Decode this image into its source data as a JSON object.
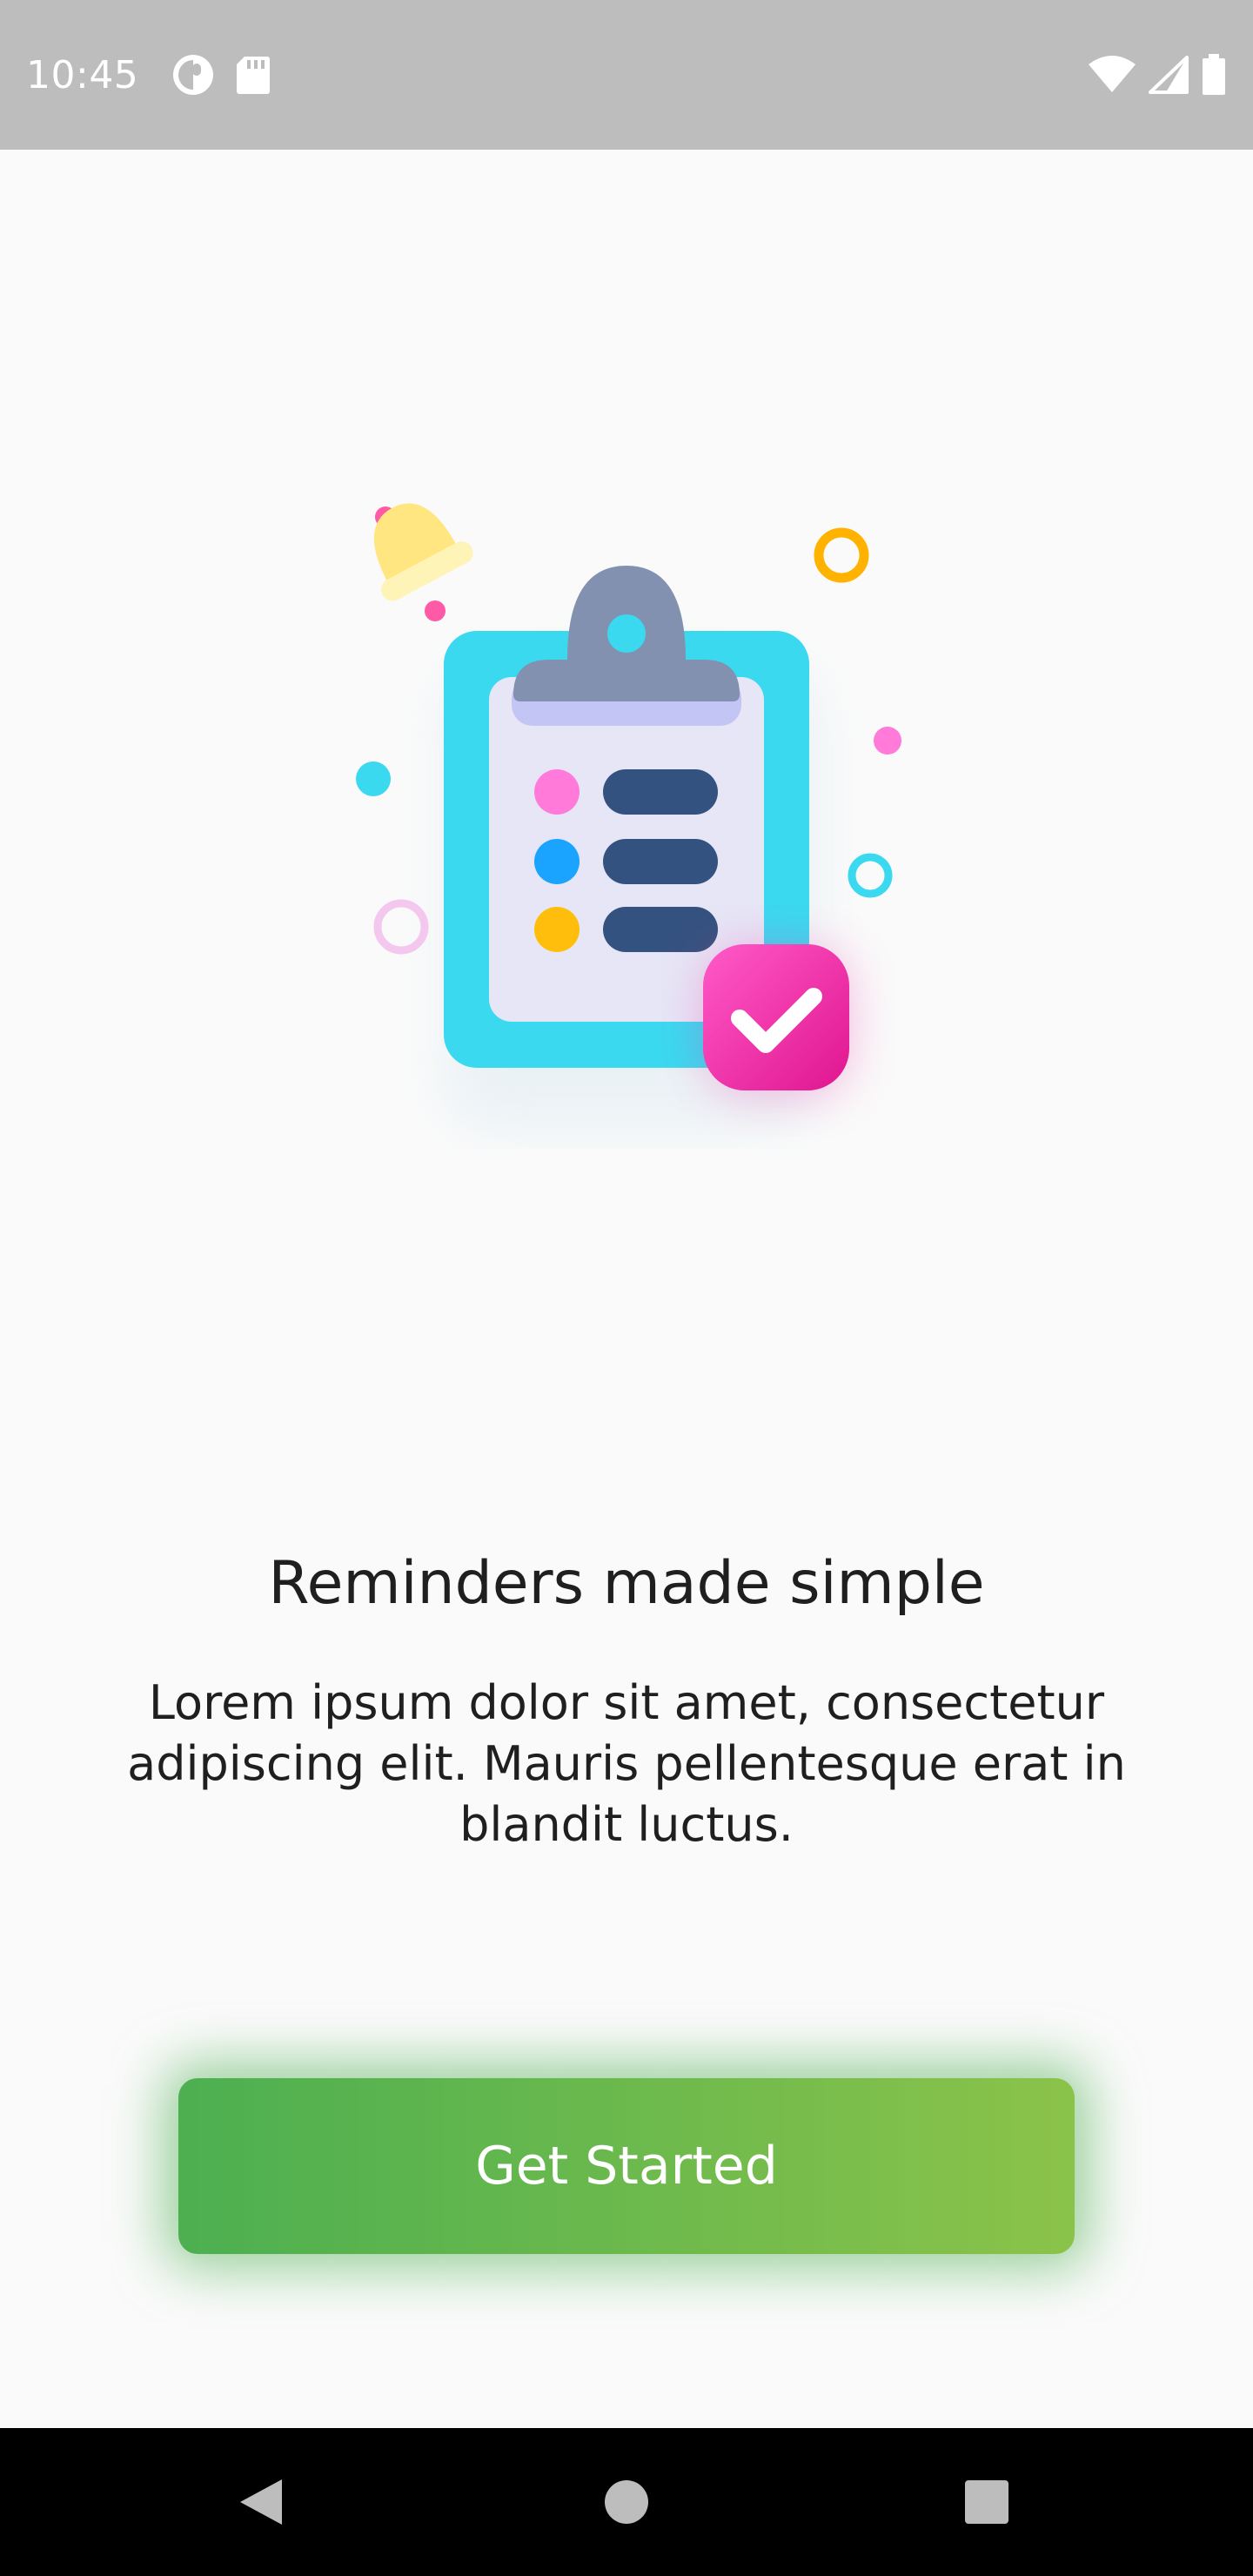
{
  "status_bar": {
    "time": "10:45",
    "left_icons": [
      "data-saver-icon",
      "sd-card-icon"
    ],
    "right_icons": [
      "wifi-icon",
      "cell-signal-icon",
      "battery-icon"
    ]
  },
  "illustration": {
    "name": "clipboard-checklist-illustration",
    "colors": {
      "clipboard_frame": "#3ad9f0",
      "paper": "#e6e6f6",
      "clip": "#8291b0",
      "list_bars": "#34527f",
      "dot_pink": "#ff7ad9",
      "dot_blue": "#1aa3ff",
      "dot_yellow": "#ffbe0b",
      "check_badge": "#ef3aa8",
      "bell": "#ffe680"
    }
  },
  "onboarding": {
    "title": "Reminders made simple",
    "description": "Lorem ipsum dolor sit amet, consectetur adipiscing elit. Mauris pellentesque erat in blandit luctus.",
    "cta_label": "Get Started",
    "cta_colors": [
      "#4caf50",
      "#8bc34a"
    ]
  },
  "nav_bar": {
    "buttons": [
      "back-icon",
      "home-icon",
      "recents-icon"
    ]
  }
}
